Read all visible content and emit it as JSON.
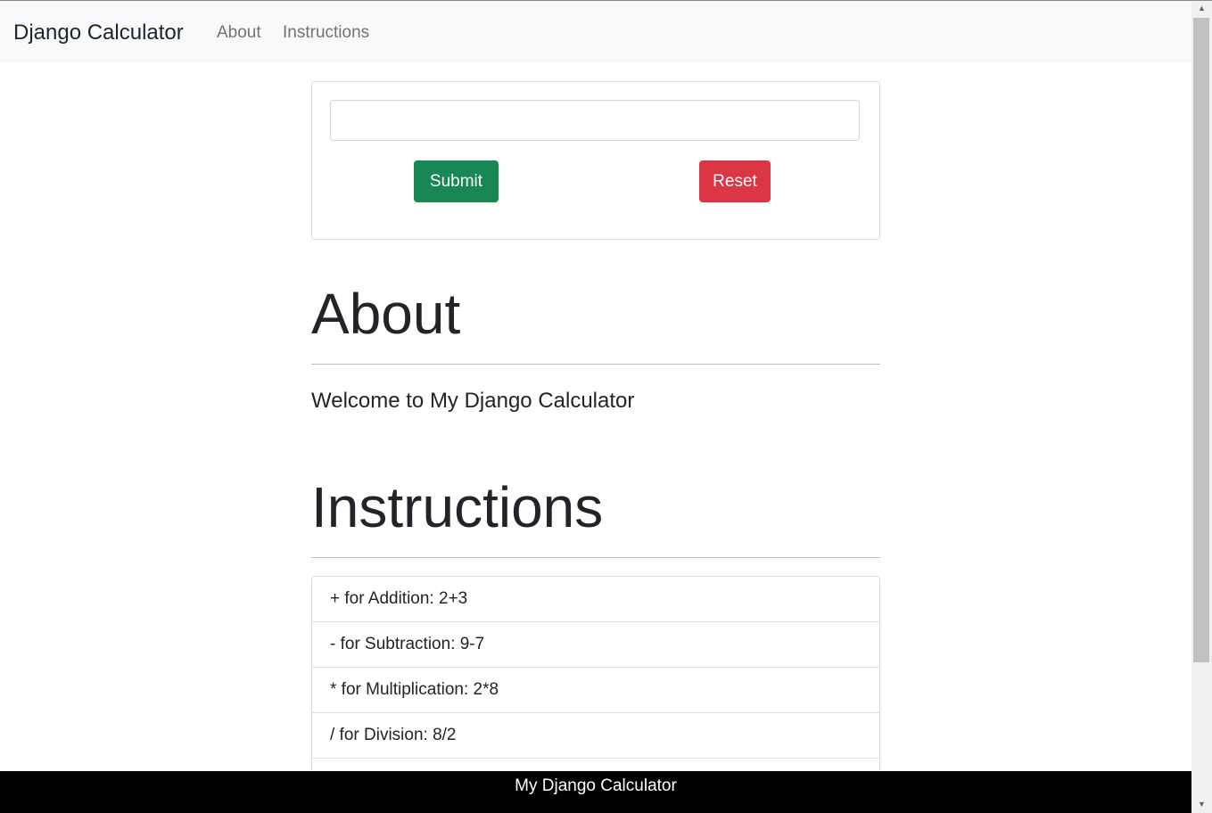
{
  "navbar": {
    "brand": "Django Calculator",
    "links": [
      "About",
      "Instructions"
    ]
  },
  "calculator": {
    "input_value": "",
    "submit_label": "Submit",
    "reset_label": "Reset"
  },
  "about": {
    "heading": "About",
    "text": "Welcome to My Django Calculator"
  },
  "instructions": {
    "heading": "Instructions",
    "items": [
      "+ for Addition: 2+3",
      "- for Subtraction: 9-7",
      "* for Multiplication: 2*8",
      "/ for Division: 8/2",
      ""
    ]
  },
  "footer": {
    "text": "My Django Calculator"
  },
  "colors": {
    "submit": "#198754",
    "reset": "#dc3545",
    "navbar_bg": "#f8f9fa",
    "footer_bg": "#000000"
  }
}
